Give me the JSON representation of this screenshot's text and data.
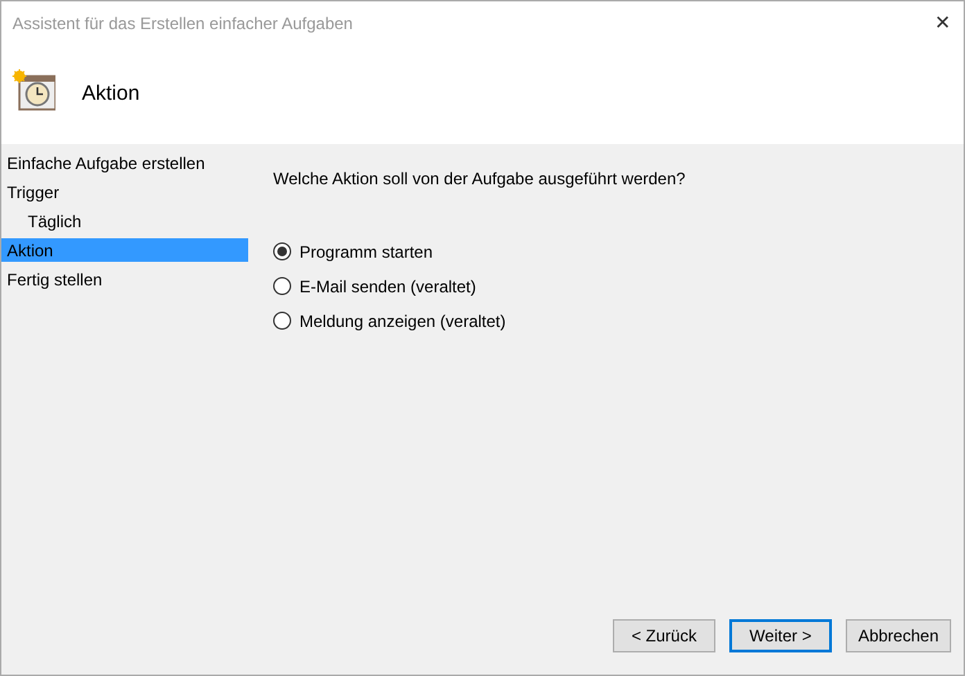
{
  "window": {
    "title": "Assistent für das Erstellen einfacher Aufgaben",
    "close": "✕"
  },
  "header": {
    "title": "Aktion"
  },
  "sidebar": {
    "items": [
      {
        "label": "Einfache Aufgabe erstellen",
        "selected": false
      },
      {
        "label": "Trigger",
        "selected": false,
        "children": [
          {
            "label": "Täglich",
            "selected": false
          }
        ]
      },
      {
        "label": "Aktion",
        "selected": true
      },
      {
        "label": "Fertig stellen",
        "selected": false
      }
    ]
  },
  "question": "Welche Aktion soll von der Aufgabe ausgeführt werden?",
  "options": [
    {
      "label": "Programm starten",
      "selected": true
    },
    {
      "label": "E-Mail senden (veraltet)",
      "selected": false
    },
    {
      "label": "Meldung anzeigen (veraltet)",
      "selected": false
    }
  ],
  "buttons": [
    {
      "label": "< Zurück",
      "default": false
    },
    {
      "label": "Weiter >",
      "default": true
    },
    {
      "label": "Abbrechen",
      "default": false
    }
  ]
}
